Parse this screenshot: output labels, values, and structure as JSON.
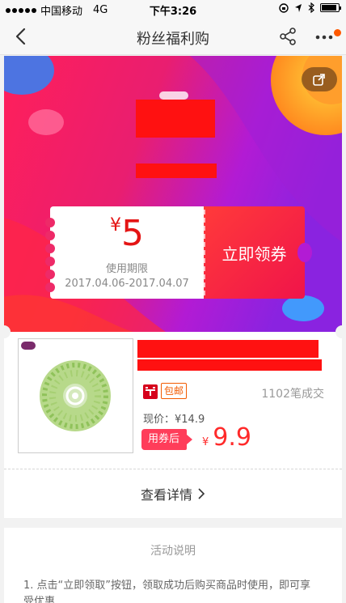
{
  "status_bar": {
    "carrier": "中国移动",
    "network": "4G",
    "time": "下午3:26",
    "icons": [
      "orientation-lock-icon",
      "location-icon",
      "bluetooth-icon",
      "battery-icon"
    ]
  },
  "nav": {
    "title": "粉丝福利购",
    "icons": [
      "back-arrow-icon",
      "share-icon",
      "more-icon"
    ]
  },
  "coupon": {
    "currency": "¥",
    "amount": "5",
    "validity_label": "使用期限",
    "validity_range": "2017.04.06-2017.04.07",
    "claim_label": "立即领券"
  },
  "product": {
    "free_shipping": "包邮",
    "sales": "1102笔成交",
    "current_price": "现价：¥14.9",
    "after_coupon_tag": "用券后",
    "final_currency": "¥",
    "final_price": "9.9"
  },
  "details_label": "查看详情",
  "activity": {
    "title": "活动说明",
    "line1": "1. 点击“立即领取”按钮，领取成功后购买商品时使用，即可享",
    "line2": "受优惠"
  },
  "colors": {
    "accent_red": "#ff2a2a",
    "banner_pink": "#e8206b",
    "banner_purple": "#9b1fd1",
    "free_ship_orange": "#f25a00"
  }
}
